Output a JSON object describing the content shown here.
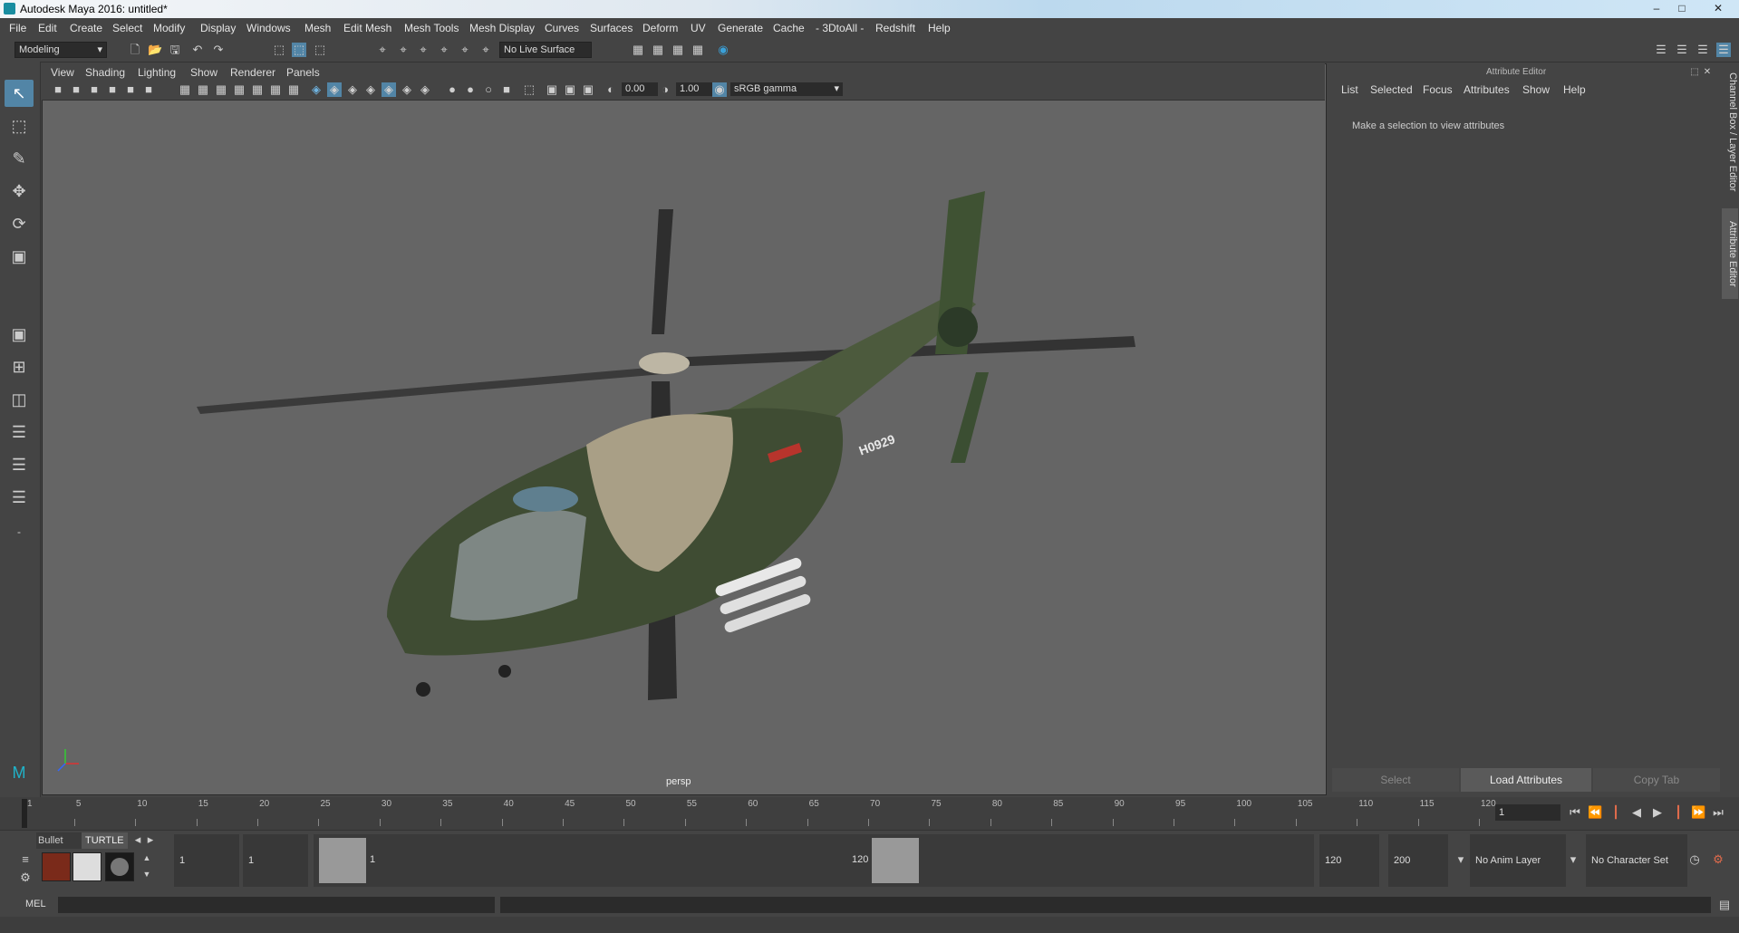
{
  "app": {
    "title": "Autodesk Maya 2016: untitled*"
  },
  "menu": [
    "File",
    "Edit",
    "Create",
    "Select",
    "Modify",
    "Display",
    "Windows",
    "Mesh",
    "Edit Mesh",
    "Mesh Tools",
    "Mesh Display",
    "Curves",
    "Surfaces",
    "Deform",
    "UV",
    "Generate",
    "Cache",
    "- 3DtoAll -",
    "Redshift",
    "Help"
  ],
  "toolbar": {
    "mode": "Modeling",
    "live_surface": "No Live Surface"
  },
  "viewport": {
    "menu": [
      "View",
      "Shading",
      "Lighting",
      "Show",
      "Renderer",
      "Panels"
    ],
    "exposure": "0.00",
    "gamma": "1.00",
    "color_space": "sRGB gamma",
    "camera_label": "persp",
    "model_marking": "H0929"
  },
  "attribute_editor": {
    "title": "Attribute Editor",
    "menu": [
      "List",
      "Selected",
      "Focus",
      "Attributes",
      "Show",
      "Help"
    ],
    "message": "Make a selection to view attributes",
    "buttons": {
      "select": "Select",
      "load": "Load Attributes",
      "copy": "Copy Tab"
    },
    "side_tabs": {
      "channel_box": "Channel Box / Layer Editor",
      "attribute_editor": "Attribute Editor"
    }
  },
  "timeline": {
    "ticks": [
      "1",
      "5",
      "10",
      "15",
      "20",
      "25",
      "30",
      "35",
      "40",
      "45",
      "50",
      "55",
      "60",
      "65",
      "70",
      "75",
      "80",
      "85",
      "90",
      "95",
      "100",
      "105",
      "110",
      "115",
      "120"
    ],
    "current_frame": "1"
  },
  "range": {
    "shelf_tabs": [
      "Bullet",
      "TURTLE"
    ],
    "start": "1",
    "playback_start": "1",
    "slider_start": "1",
    "slider_end": "120",
    "playback_end": "120",
    "end": "200",
    "anim_layer": "No Anim Layer",
    "character_set": "No Character Set"
  },
  "cmd": {
    "label": "MEL"
  }
}
